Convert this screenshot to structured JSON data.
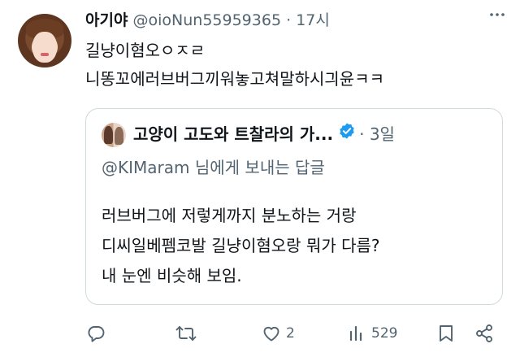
{
  "tweet": {
    "author_name": "아기야",
    "handle": "@oioNun55959365",
    "separator": "·",
    "time": "17시",
    "text_lines": [
      "길냥이혐오ㅇㅈㄹ",
      "니똥꼬에러브버그끼워놓고쳐말하시긔윤ㅋㅋ"
    ]
  },
  "quoted": {
    "author_name": "고양이 고도와 트찰라의 가...",
    "separator": "·",
    "time": "3일",
    "reply_mention": "@KIMaram",
    "reply_suffix": "님에게 보내는 답글",
    "text_lines": [
      "러브버그에 저렇게까지 분노하는 거랑",
      "디씨일베펨코발 길냥이혐오랑 뭐가 다름?",
      "내 눈엔 비슷해 보임."
    ]
  },
  "actions": {
    "reply_count": "",
    "retweet_count": "",
    "like_count": "2",
    "views_count": "529"
  },
  "colors": {
    "text": "#0f1419",
    "secondary": "#536471",
    "border": "#cfd9de",
    "verified": "#1d9bf0"
  },
  "icons": [
    "more-icon",
    "verified-badge-icon",
    "reply-icon",
    "retweet-icon",
    "like-icon",
    "views-icon",
    "bookmark-icon",
    "share-icon"
  ]
}
